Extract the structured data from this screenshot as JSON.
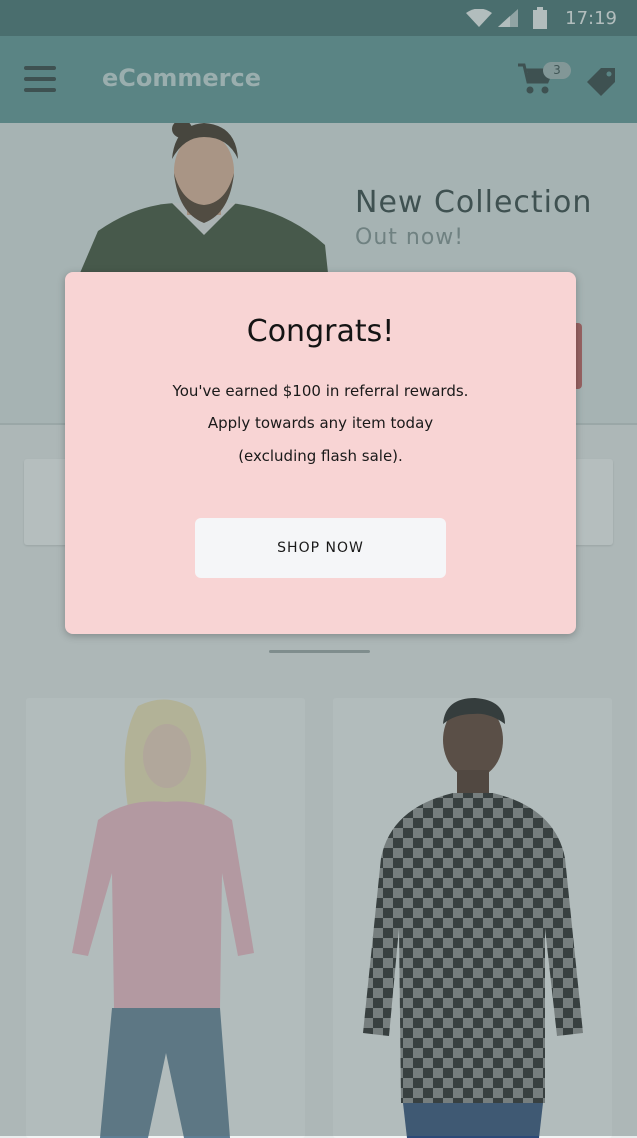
{
  "status_bar": {
    "time": "17:19",
    "icons": [
      "wifi-icon",
      "signal-icon",
      "battery-icon"
    ]
  },
  "app_bar": {
    "title": "eCommerce",
    "cart_count": "3"
  },
  "hero": {
    "title": "New Collection",
    "subtitle": "Out now!"
  },
  "modal": {
    "title": "Congrats!",
    "line1": "You've earned $100 in referral rewards.",
    "line2": "Apply towards any item today",
    "line3": "(excluding flash sale).",
    "button_label": "SHOP NOW"
  },
  "colors": {
    "app_bar": "#5a9595",
    "status_bar": "#3f6f6e",
    "modal_bg": "#f8d4d4",
    "accent": "#c35a5a"
  }
}
